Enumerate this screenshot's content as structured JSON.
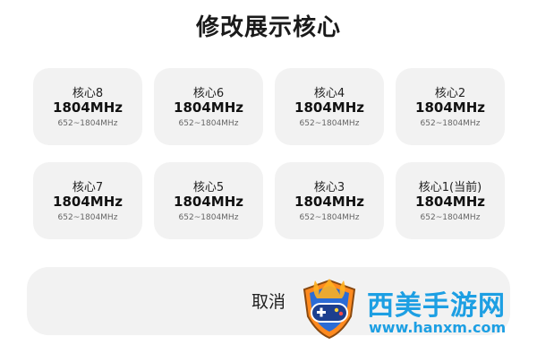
{
  "dialog": {
    "title": "修改展示核心",
    "cores": [
      {
        "name": "核心8",
        "freq": "1804MHz",
        "range": "652~1804MHz"
      },
      {
        "name": "核心6",
        "freq": "1804MHz",
        "range": "652~1804MHz"
      },
      {
        "name": "核心4",
        "freq": "1804MHz",
        "range": "652~1804MHz"
      },
      {
        "name": "核心2",
        "freq": "1804MHz",
        "range": "652~1804MHz"
      },
      {
        "name": "核心7",
        "freq": "1804MHz",
        "range": "652~1804MHz"
      },
      {
        "name": "核心5",
        "freq": "1804MHz",
        "range": "652~1804MHz"
      },
      {
        "name": "核心3",
        "freq": "1804MHz",
        "range": "652~1804MHz"
      },
      {
        "name": "核心1(当前)",
        "freq": "1804MHz",
        "range": "652~1804MHz"
      }
    ],
    "cancel_label": "取消"
  },
  "watermark": {
    "brand": "西美手游网",
    "url": "www.hanxm.com",
    "icon": "gamepad-shield-logo",
    "color": "#1d9fe3"
  }
}
